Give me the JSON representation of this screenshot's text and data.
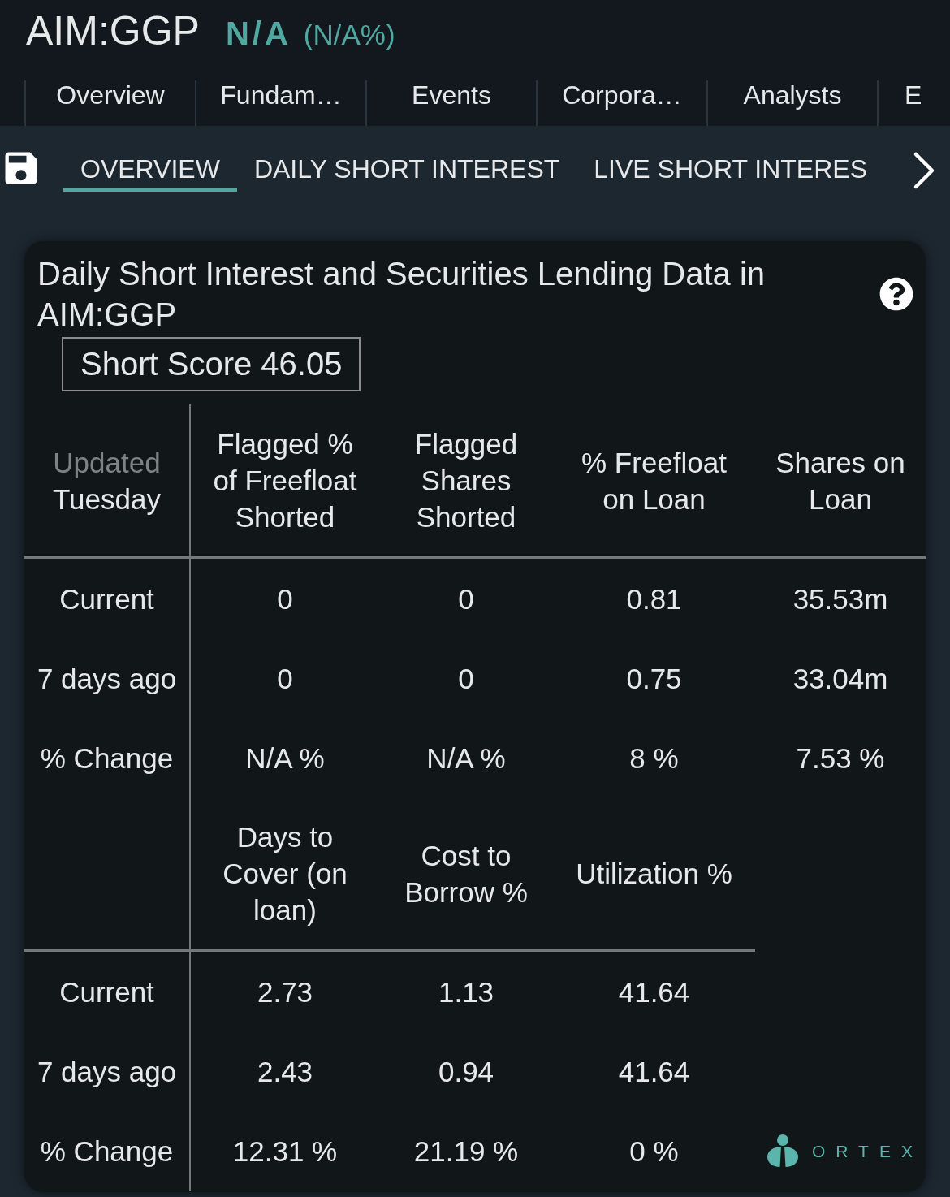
{
  "header": {
    "symbol": "AIM:GGP",
    "price": "N/A",
    "change": "(N/A%)"
  },
  "nav_tabs": [
    {
      "label": "Overview"
    },
    {
      "label": "Fundam…"
    },
    {
      "label": "Events"
    },
    {
      "label": "Corpora…"
    },
    {
      "label": "Analysts"
    },
    {
      "label": "E"
    }
  ],
  "sub_tabs": [
    {
      "label": "OVERVIEW",
      "selected": true
    },
    {
      "label": "DAILY SHORT INTEREST",
      "selected": false
    },
    {
      "label": "LIVE SHORT INTERES",
      "selected": false
    }
  ],
  "card": {
    "title": "Daily Short Interest and Securities Lending Data in AIM:GGP",
    "short_score": "Short Score 46.05",
    "tables": [
      {
        "corner": {
          "label": "Updated",
          "value": "Tuesday"
        },
        "columns": [
          "Flagged % of Freefloat Shorted",
          "Flagged Shares Shorted",
          "% Freefloat on Loan",
          "Shares on Loan"
        ],
        "rows": [
          {
            "label": "Current",
            "cells": [
              "0",
              "0",
              "0.81",
              "35.53m"
            ]
          },
          {
            "label": "7 days ago",
            "cells": [
              "0",
              "0",
              "0.75",
              "33.04m"
            ]
          },
          {
            "label": "% Change",
            "cells": [
              "N/A %",
              "N/A %",
              "8 %",
              "7.53 %"
            ]
          }
        ]
      },
      {
        "columns": [
          "Days to Cover (on loan)",
          "Cost to Borrow %",
          "Utilization %"
        ],
        "rows": [
          {
            "label": "Current",
            "cells": [
              "2.73",
              "1.13",
              "41.64"
            ]
          },
          {
            "label": "7 days ago",
            "cells": [
              "2.43",
              "0.94",
              "41.64"
            ]
          },
          {
            "label": "% Change",
            "cells": [
              "12.31 %",
              "21.19 %",
              "0 %"
            ]
          }
        ]
      }
    ],
    "logo": {
      "text": "ORTEX"
    }
  }
}
